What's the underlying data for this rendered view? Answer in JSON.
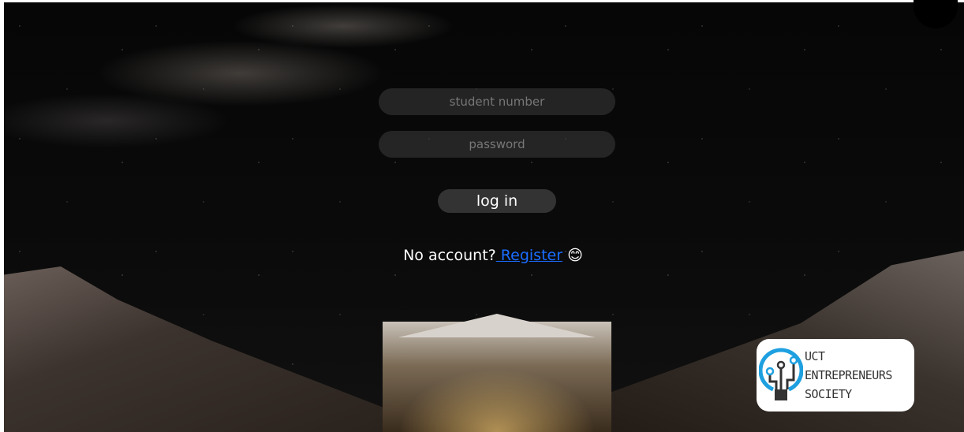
{
  "login": {
    "student_number_placeholder": "student number",
    "password_placeholder": "password",
    "login_label": "log in",
    "no_account_text": "No account?",
    "register_link": " Register",
    "emoji": "😊"
  },
  "logo": {
    "line1": "UCT",
    "line2": "ENTREPRENEURS",
    "line3": "SOCIETY"
  },
  "colors": {
    "link": "#1a6dff",
    "logo_blue": "#1ea0e0"
  }
}
